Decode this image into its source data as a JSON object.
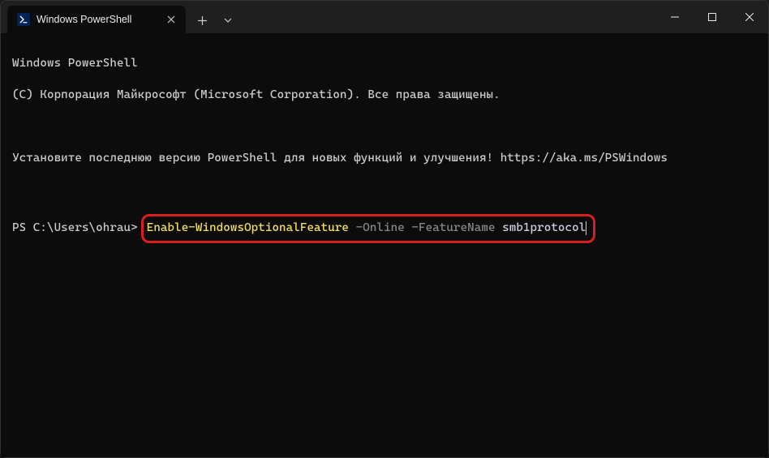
{
  "titlebar": {
    "tab_title": "Windows PowerShell"
  },
  "terminal": {
    "line1": "Windows PowerShell",
    "line2": "(C) Корпорация Майкрософт (Microsoft Corporation). Все права защищены.",
    "line3": "Установите последнюю версию PowerShell для новых функций и улучшения! https://aka.ms/PSWindows",
    "prompt": "PS C:\\Users\\ohrau>",
    "cmd_cmdlet": "Enable-WindowsOptionalFeature",
    "cmd_flag1": " -Online",
    "cmd_flag2": " -FeatureName",
    "cmd_arg": " smb1protocol"
  }
}
